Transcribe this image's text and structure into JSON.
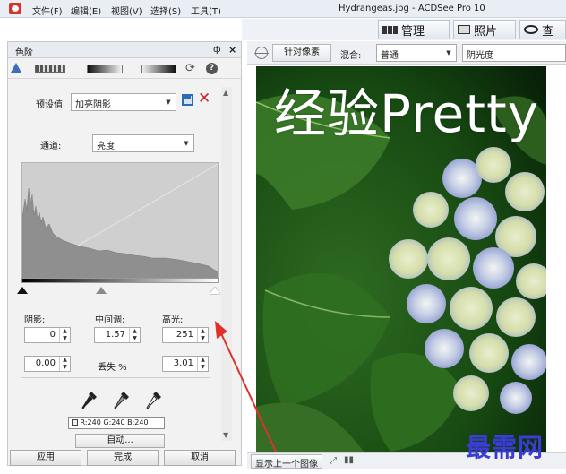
{
  "menubar": {
    "items": [
      "文件(F)",
      "编辑(E)",
      "视图(V)",
      "选择(S)",
      "工具(T)"
    ],
    "window_title": "Hydrangeas.jpg - ACDSee Pro 10"
  },
  "modes": {
    "manage": "管理",
    "photos": "照片",
    "view_partial": "查"
  },
  "panel": {
    "title": "色阶",
    "pin": "ф",
    "close": "×",
    "preset_label": "预设值",
    "preset_value": "加亮阴影",
    "channel_label": "通道:",
    "channel_value": "亮度",
    "shadow_label": "阴影:",
    "midtone_label": "中间调:",
    "highlight_label": "高光:",
    "shadow_value": "0",
    "midtone_value": "1.57",
    "highlight_value": "251",
    "clip_low_value": "0.00",
    "clip_label": "丢失 %",
    "clip_high_value": "3.01",
    "rgb_readout": "R:240  G:240  B:240",
    "auto_label": "自动...",
    "apply_label": "应用",
    "done_label": "完成",
    "cancel_label": "取消"
  },
  "levels": {
    "shadow": 0,
    "midtone": 1.57,
    "highlight": 251
  },
  "image_toolbar": {
    "target_pixel_label": "针对像素",
    "blend_label": "混合:",
    "blend_value": "普通",
    "blend_mode_partial": "阴光度"
  },
  "image": {
    "overlay_text": "经验Pretty"
  },
  "status": {
    "previous_image": "显示上一个图像"
  },
  "watermark": "最需网",
  "colors": {
    "accent_blue": "#2c6bb5",
    "delete_red": "#d32020",
    "arrow_red": "#e0312b",
    "watermark": "#3b3bd6"
  }
}
